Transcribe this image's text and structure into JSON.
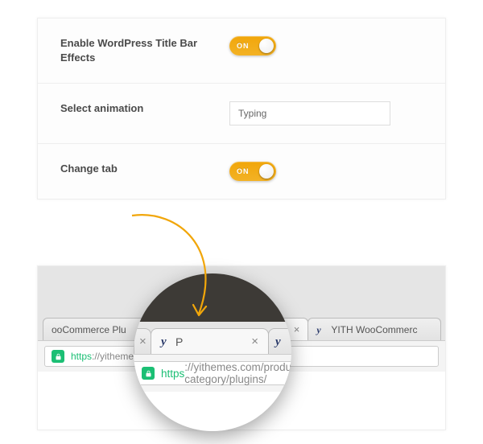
{
  "settings": {
    "rows": [
      {
        "label": "Enable WordPress Title Bar Effects",
        "toggle_text": "ON"
      },
      {
        "label": "Select animation",
        "select_value": "Typing"
      },
      {
        "label": "Change tab",
        "toggle_text": "ON"
      }
    ]
  },
  "browser": {
    "tabs": [
      {
        "title": "ooCommerce Plu",
        "favicon": "",
        "close": "×"
      },
      {
        "title": "P",
        "favicon": "y",
        "close": "×",
        "active": true
      },
      {
        "title": "YITH WooCommerc",
        "favicon": "y",
        "close": ""
      }
    ],
    "url": {
      "scheme": "https",
      "rest": "://yithemes.com/product-category/plugins/"
    }
  },
  "magnifier": {
    "tabs": {
      "left": {
        "close": "×"
      },
      "center": {
        "favicon": "y",
        "title": "P",
        "close": "×"
      },
      "right": {
        "favicon": "y",
        "title": "YITH WooCommerc"
      }
    },
    "url": {
      "scheme": "https",
      "rest": "://yithemes.com/product-category/plugins/"
    }
  },
  "colors": {
    "accent": "#f1a60a",
    "secure": "#1bbf74"
  }
}
